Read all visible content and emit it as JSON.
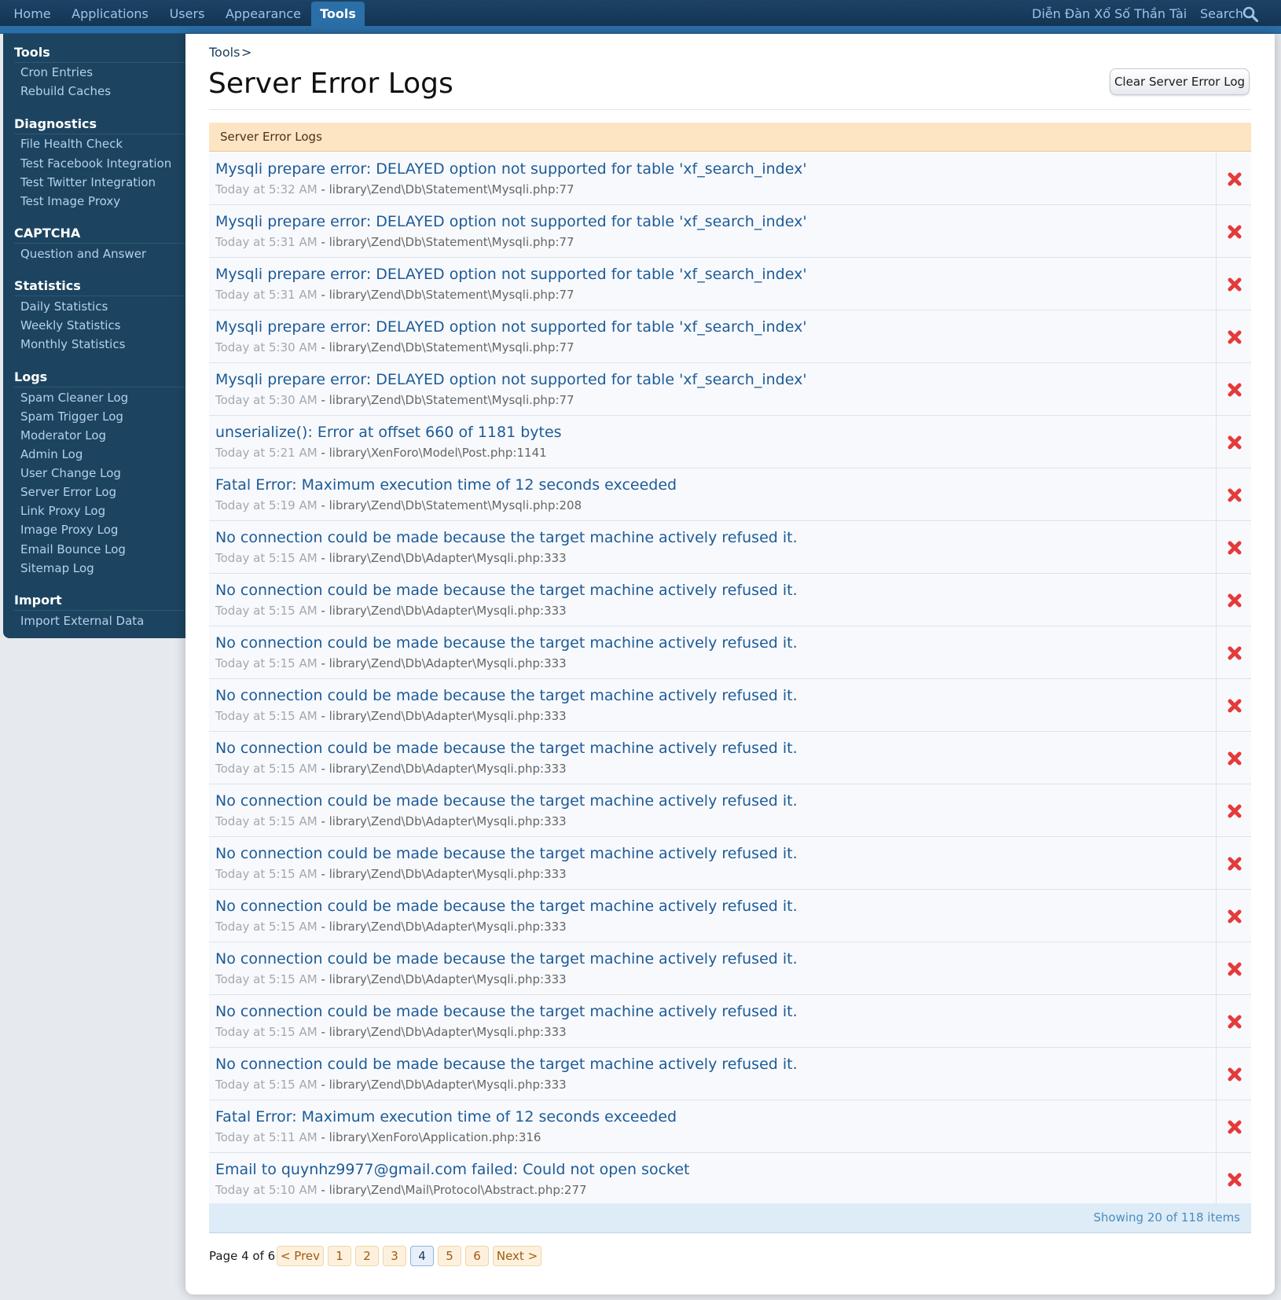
{
  "topnav": {
    "tabs": [
      "Home",
      "Applications",
      "Users",
      "Appearance",
      "Tools"
    ],
    "selected_tab": "Tools",
    "site_title": "Diễn Đàn Xổ Số Thần Tài",
    "search_label": "Search"
  },
  "sidebar": {
    "sections": [
      {
        "heading": "Tools",
        "items": [
          "Cron Entries",
          "Rebuild Caches"
        ]
      },
      {
        "heading": "Diagnostics",
        "items": [
          "File Health Check",
          "Test Facebook Integration",
          "Test Twitter Integration",
          "Test Image Proxy"
        ]
      },
      {
        "heading": "CAPTCHA",
        "items": [
          "Question and Answer"
        ]
      },
      {
        "heading": "Statistics",
        "items": [
          "Daily Statistics",
          "Weekly Statistics",
          "Monthly Statistics"
        ]
      },
      {
        "heading": "Logs",
        "items": [
          "Spam Cleaner Log",
          "Spam Trigger Log",
          "Moderator Log",
          "Admin Log",
          "User Change Log",
          "Server Error Log",
          "Link Proxy Log",
          "Image Proxy Log",
          "Email Bounce Log",
          "Sitemap Log"
        ]
      },
      {
        "heading": "Import",
        "items": [
          "Import External Data"
        ]
      }
    ]
  },
  "main": {
    "breadcrumb": {
      "link": "Tools",
      "separator": ">"
    },
    "title": "Server Error Logs",
    "clear_button": "Clear Server Error Log",
    "list_header": "Server Error Logs",
    "entries": [
      {
        "message": "Mysqli prepare error: DELAYED option not supported for table 'xf_search_index'",
        "time": "Today at 5:32 AM",
        "file": "library\\Zend\\Db\\Statement\\Mysqli.php:77"
      },
      {
        "message": "Mysqli prepare error: DELAYED option not supported for table 'xf_search_index'",
        "time": "Today at 5:31 AM",
        "file": "library\\Zend\\Db\\Statement\\Mysqli.php:77"
      },
      {
        "message": "Mysqli prepare error: DELAYED option not supported for table 'xf_search_index'",
        "time": "Today at 5:31 AM",
        "file": "library\\Zend\\Db\\Statement\\Mysqli.php:77"
      },
      {
        "message": "Mysqli prepare error: DELAYED option not supported for table 'xf_search_index'",
        "time": "Today at 5:30 AM",
        "file": "library\\Zend\\Db\\Statement\\Mysqli.php:77"
      },
      {
        "message": "Mysqli prepare error: DELAYED option not supported for table 'xf_search_index'",
        "time": "Today at 5:30 AM",
        "file": "library\\Zend\\Db\\Statement\\Mysqli.php:77"
      },
      {
        "message": "unserialize(): Error at offset 660 of 1181 bytes",
        "time": "Today at 5:21 AM",
        "file": "library\\XenForo\\Model\\Post.php:1141"
      },
      {
        "message": "Fatal Error: Maximum execution time of 12 seconds exceeded",
        "time": "Today at 5:19 AM",
        "file": "library\\Zend\\Db\\Statement\\Mysqli.php:208"
      },
      {
        "message": "No connection could be made because the target machine actively refused it.",
        "time": "Today at 5:15 AM",
        "file": "library\\Zend\\Db\\Adapter\\Mysqli.php:333"
      },
      {
        "message": "No connection could be made because the target machine actively refused it.",
        "time": "Today at 5:15 AM",
        "file": "library\\Zend\\Db\\Adapter\\Mysqli.php:333"
      },
      {
        "message": "No connection could be made because the target machine actively refused it.",
        "time": "Today at 5:15 AM",
        "file": "library\\Zend\\Db\\Adapter\\Mysqli.php:333"
      },
      {
        "message": "No connection could be made because the target machine actively refused it.",
        "time": "Today at 5:15 AM",
        "file": "library\\Zend\\Db\\Adapter\\Mysqli.php:333"
      },
      {
        "message": "No connection could be made because the target machine actively refused it.",
        "time": "Today at 5:15 AM",
        "file": "library\\Zend\\Db\\Adapter\\Mysqli.php:333"
      },
      {
        "message": "No connection could be made because the target machine actively refused it.",
        "time": "Today at 5:15 AM",
        "file": "library\\Zend\\Db\\Adapter\\Mysqli.php:333"
      },
      {
        "message": "No connection could be made because the target machine actively refused it.",
        "time": "Today at 5:15 AM",
        "file": "library\\Zend\\Db\\Adapter\\Mysqli.php:333"
      },
      {
        "message": "No connection could be made because the target machine actively refused it.",
        "time": "Today at 5:15 AM",
        "file": "library\\Zend\\Db\\Adapter\\Mysqli.php:333"
      },
      {
        "message": "No connection could be made because the target machine actively refused it.",
        "time": "Today at 5:15 AM",
        "file": "library\\Zend\\Db\\Adapter\\Mysqli.php:333"
      },
      {
        "message": "No connection could be made because the target machine actively refused it.",
        "time": "Today at 5:15 AM",
        "file": "library\\Zend\\Db\\Adapter\\Mysqli.php:333"
      },
      {
        "message": "No connection could be made because the target machine actively refused it.",
        "time": "Today at 5:15 AM",
        "file": "library\\Zend\\Db\\Adapter\\Mysqli.php:333"
      },
      {
        "message": "Fatal Error: Maximum execution time of 12 seconds exceeded",
        "time": "Today at 5:11 AM",
        "file": "library\\XenForo\\Application.php:316"
      },
      {
        "message": "Email to quynhz9977@gmail.com failed: Could not open socket",
        "time": "Today at 5:10 AM",
        "file": "library\\Zend\\Mail\\Protocol\\Abstract.php:277"
      }
    ],
    "meta_separator": "-",
    "footer": "Showing 20 of 118 items",
    "pagination": {
      "label": "Page 4 of 6",
      "prev": "< Prev",
      "pages": [
        "1",
        "2",
        "3",
        "4",
        "5",
        "6"
      ],
      "current": "4",
      "next": "Next >"
    }
  },
  "colors": {
    "nav_bg": "#1c4265",
    "nav_selected": "#2b6fa8",
    "sidebar_bg": "#1c4460",
    "link": "#1c5b98",
    "list_header_bg": "#fde5c3",
    "delete_icon": "#e53a3a"
  },
  "icons": {
    "search": "search-icon",
    "delete": "delete-icon"
  }
}
